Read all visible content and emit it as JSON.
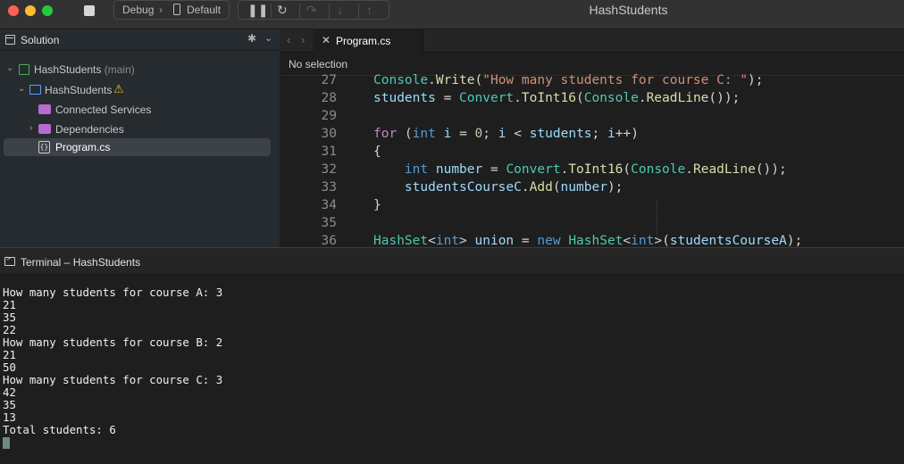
{
  "window": {
    "title": "HashStudents",
    "config": {
      "mode": "Debug",
      "device": "Default"
    }
  },
  "solution_pad": {
    "title": "Solution",
    "tree": [
      {
        "label": "HashStudents",
        "sub": "(main)",
        "icon": "solution-icon"
      },
      {
        "label": "HashStudents",
        "icon": "csharp-project-icon",
        "warning": true
      },
      {
        "label": "Connected Services",
        "icon": "connected-services-folder-icon"
      },
      {
        "label": "Dependencies",
        "icon": "dependencies-folder-icon"
      },
      {
        "label": "Program.cs",
        "icon": "csharp-file-icon",
        "selected": true
      }
    ]
  },
  "editor": {
    "tab_label": "Program.cs",
    "breadcrumb": "No selection",
    "lines": [
      {
        "number": "27",
        "tokens": [
          [
            "tk-type",
            "Console"
          ],
          [
            "tk-punct",
            "."
          ],
          [
            "tk-method",
            "Write"
          ],
          [
            "tk-punct",
            "("
          ],
          [
            "tk-string",
            "\"How many students for course C: \""
          ],
          [
            "tk-punct",
            ");"
          ]
        ]
      },
      {
        "number": "28",
        "tokens": [
          [
            "tk-ident",
            "students"
          ],
          [
            "tk-punct",
            " = "
          ],
          [
            "tk-type",
            "Convert"
          ],
          [
            "tk-punct",
            "."
          ],
          [
            "tk-method",
            "ToInt16"
          ],
          [
            "tk-punct",
            "("
          ],
          [
            "tk-type",
            "Console"
          ],
          [
            "tk-punct",
            "."
          ],
          [
            "tk-method",
            "ReadLine"
          ],
          [
            "tk-punct",
            "());"
          ]
        ]
      },
      {
        "number": "29",
        "tokens": []
      },
      {
        "number": "30",
        "tokens": [
          [
            "tk-keyword",
            "for"
          ],
          [
            "tk-punct",
            " ("
          ],
          [
            "tk-kwtype",
            "int"
          ],
          [
            "tk-punct",
            " "
          ],
          [
            "tk-ident",
            "i"
          ],
          [
            "tk-punct",
            " = "
          ],
          [
            "tk-number",
            "0"
          ],
          [
            "tk-punct",
            "; "
          ],
          [
            "tk-ident",
            "i"
          ],
          [
            "tk-punct",
            " < "
          ],
          [
            "tk-ident",
            "students"
          ],
          [
            "tk-punct",
            "; "
          ],
          [
            "tk-ident",
            "i"
          ],
          [
            "tk-punct",
            "++)"
          ]
        ]
      },
      {
        "number": "31",
        "tokens": [
          [
            "tk-punct",
            "{"
          ]
        ]
      },
      {
        "number": "32",
        "tokens": [
          [
            "tk-punct",
            "    "
          ],
          [
            "tk-kwtype",
            "int"
          ],
          [
            "tk-punct",
            " "
          ],
          [
            "tk-ident",
            "number"
          ],
          [
            "tk-punct",
            " = "
          ],
          [
            "tk-type",
            "Convert"
          ],
          [
            "tk-punct",
            "."
          ],
          [
            "tk-method",
            "ToInt16"
          ],
          [
            "tk-punct",
            "("
          ],
          [
            "tk-type",
            "Console"
          ],
          [
            "tk-punct",
            "."
          ],
          [
            "tk-method",
            "ReadLine"
          ],
          [
            "tk-punct",
            "());"
          ]
        ]
      },
      {
        "number": "33",
        "tokens": [
          [
            "tk-punct",
            "    "
          ],
          [
            "tk-ident",
            "studentsCourseC"
          ],
          [
            "tk-punct",
            "."
          ],
          [
            "tk-method",
            "Add"
          ],
          [
            "tk-punct",
            "("
          ],
          [
            "tk-ident",
            "number"
          ],
          [
            "tk-punct",
            ");"
          ]
        ]
      },
      {
        "number": "34",
        "tokens": [
          [
            "tk-punct",
            "}"
          ]
        ]
      },
      {
        "number": "35",
        "tokens": []
      },
      {
        "number": "36",
        "tokens": [
          [
            "tk-type",
            "HashSet"
          ],
          [
            "tk-punct",
            "<"
          ],
          [
            "tk-kwtype",
            "int"
          ],
          [
            "tk-punct",
            "> "
          ],
          [
            "tk-ident",
            "union"
          ],
          [
            "tk-punct",
            " = "
          ],
          [
            "tk-kwtype",
            "new"
          ],
          [
            "tk-punct",
            " "
          ],
          [
            "tk-type",
            "HashSet"
          ],
          [
            "tk-punct",
            "<"
          ],
          [
            "tk-kwtype",
            "int"
          ],
          [
            "tk-punct",
            ">("
          ],
          [
            "tk-ident",
            "studentsCourseA"
          ],
          [
            "tk-punct",
            ");"
          ]
        ]
      }
    ]
  },
  "terminal": {
    "title": "Terminal – HashStudents",
    "output": [
      "How many students for course A: 3",
      "21",
      "35",
      "22",
      "How many students for course B: 2",
      "21",
      "50",
      "How many students for course C: 3",
      "42",
      "35",
      "13",
      "Total students: 6"
    ]
  }
}
